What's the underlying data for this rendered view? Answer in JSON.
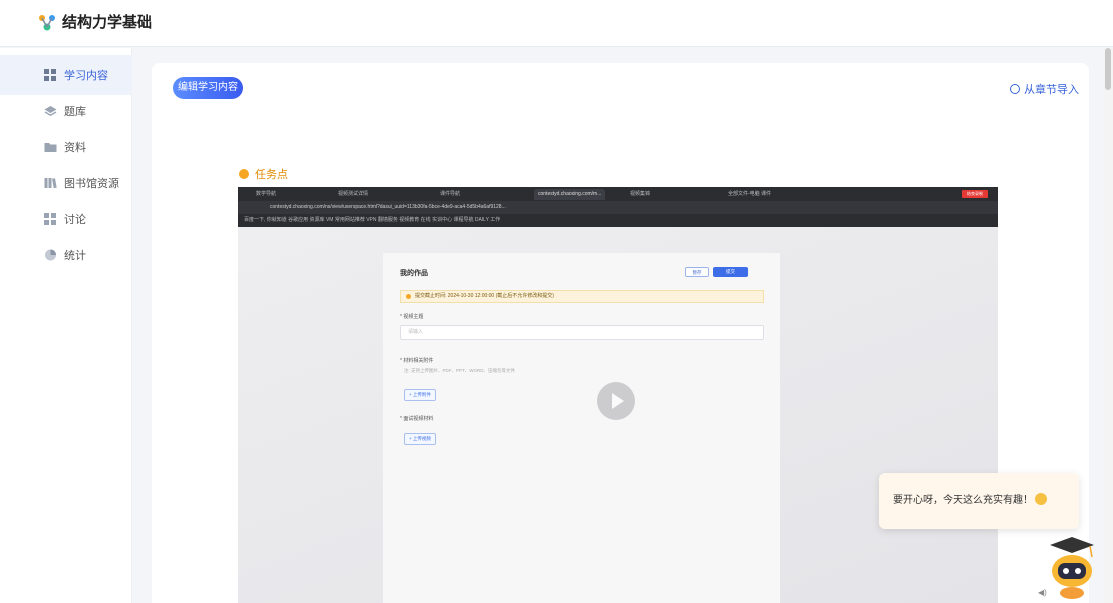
{
  "app": {
    "title": "结构力学基础",
    "logo_icon": "molecule-icon"
  },
  "sidebar": {
    "items": [
      {
        "label": "学习内容",
        "icon": "grid-icon",
        "active": true
      },
      {
        "label": "题库",
        "icon": "layers-icon",
        "active": false
      },
      {
        "label": "资料",
        "icon": "folder-icon",
        "active": false
      },
      {
        "label": "图书馆资源",
        "icon": "books-icon",
        "active": false
      },
      {
        "label": "讨论",
        "icon": "grid-icon",
        "active": false
      },
      {
        "label": "统计",
        "icon": "pie-icon",
        "active": false
      }
    ]
  },
  "header": {
    "edit_button": "编辑学习内容",
    "import_link": "从章节导入"
  },
  "task": {
    "label": "任务点"
  },
  "video": {
    "browser": {
      "tabs": [
        "数学导航",
        "视频测试详情",
        "课件导航",
        "contestyd.chaoxing.com/m...",
        "视频集锦",
        "全部文件-电脑 课件"
      ],
      "url": "contestyd.chaoxing.com/ns/view/userspace.html?dasui_uuid=113b30fa-5bce-4de9-aca4-5d5b4a6af9128...",
      "bookmarks": "百度一下, 你就知道   谷歌应用   资源库   VM   常用网站推荐   VPN 翻墙服务   视频教育   在线   实训中心   课程导航   DAILY 工作",
      "rec_label": "结束录制"
    },
    "form": {
      "title": "我的作品",
      "save": "暂存",
      "submit": "提交",
      "notice": "提交截止时间: 2024-10-30 12:00:00 (截止后不允许修改和提交)",
      "topic_label": "* 视频主题",
      "topic_placeholder": "请输入",
      "attach_label": "* 材料相关附件",
      "attach_hint": "注: 支持上传图片、PDF、PPT、WORD、压缩包等文件",
      "upload_attach": "+ 上传附件",
      "video_label": "* 面试视频材料",
      "upload_video": "+ 上传视频"
    }
  },
  "assistant": {
    "bubble": "要开心呀，今天这么充实有趣！"
  },
  "colors": {
    "accent": "#3a64d8",
    "task": "#f5a623"
  }
}
